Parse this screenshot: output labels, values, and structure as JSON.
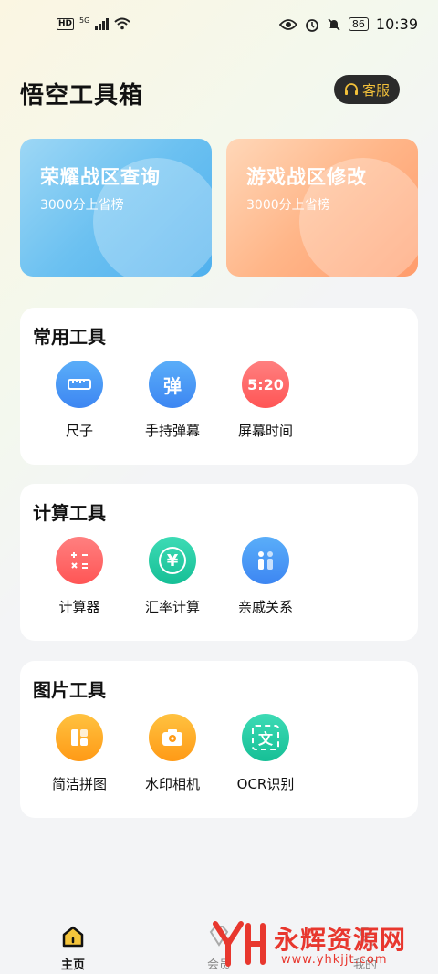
{
  "status_bar": {
    "hd": "HD",
    "network": "5G",
    "battery": "86",
    "time": "10:39"
  },
  "header": {
    "title": "悟空工具箱",
    "service_label": "客服"
  },
  "banners": [
    {
      "title": "荣耀战区查询",
      "subtitle": "3000分上省榜"
    },
    {
      "title": "游戏战区修改",
      "subtitle": "3000分上省榜"
    }
  ],
  "sections": [
    {
      "title": "常用工具",
      "tools": [
        {
          "label": "尺子",
          "icon": "ruler-icon"
        },
        {
          "label": "手持弹幕",
          "icon": "bullet-comment-icon",
          "glyph": "弹"
        },
        {
          "label": "屏幕时间",
          "icon": "screen-time-icon",
          "glyph": "5:20"
        }
      ]
    },
    {
      "title": "计算工具",
      "tools": [
        {
          "label": "计算器",
          "icon": "calculator-icon"
        },
        {
          "label": "汇率计算",
          "icon": "exchange-rate-icon",
          "glyph": "¥"
        },
        {
          "label": "亲戚关系",
          "icon": "relatives-icon"
        }
      ]
    },
    {
      "title": "图片工具",
      "tools": [
        {
          "label": "简洁拼图",
          "icon": "collage-icon"
        },
        {
          "label": "水印相机",
          "icon": "watermark-camera-icon"
        },
        {
          "label": "OCR识别",
          "icon": "ocr-icon",
          "glyph": "文"
        }
      ]
    }
  ],
  "tabs": [
    {
      "label": "主页",
      "active": true
    },
    {
      "label": "会员",
      "active": false
    },
    {
      "label": "我的",
      "active": false
    }
  ],
  "watermark": {
    "brand": "永辉资源网",
    "url": "www.yhkjjt.com"
  },
  "colors": {
    "accent": "#f2c03a",
    "blue": "#3d92f5",
    "red": "#ff5e5e",
    "green": "#22c9a0",
    "orange": "#ffa32a"
  }
}
